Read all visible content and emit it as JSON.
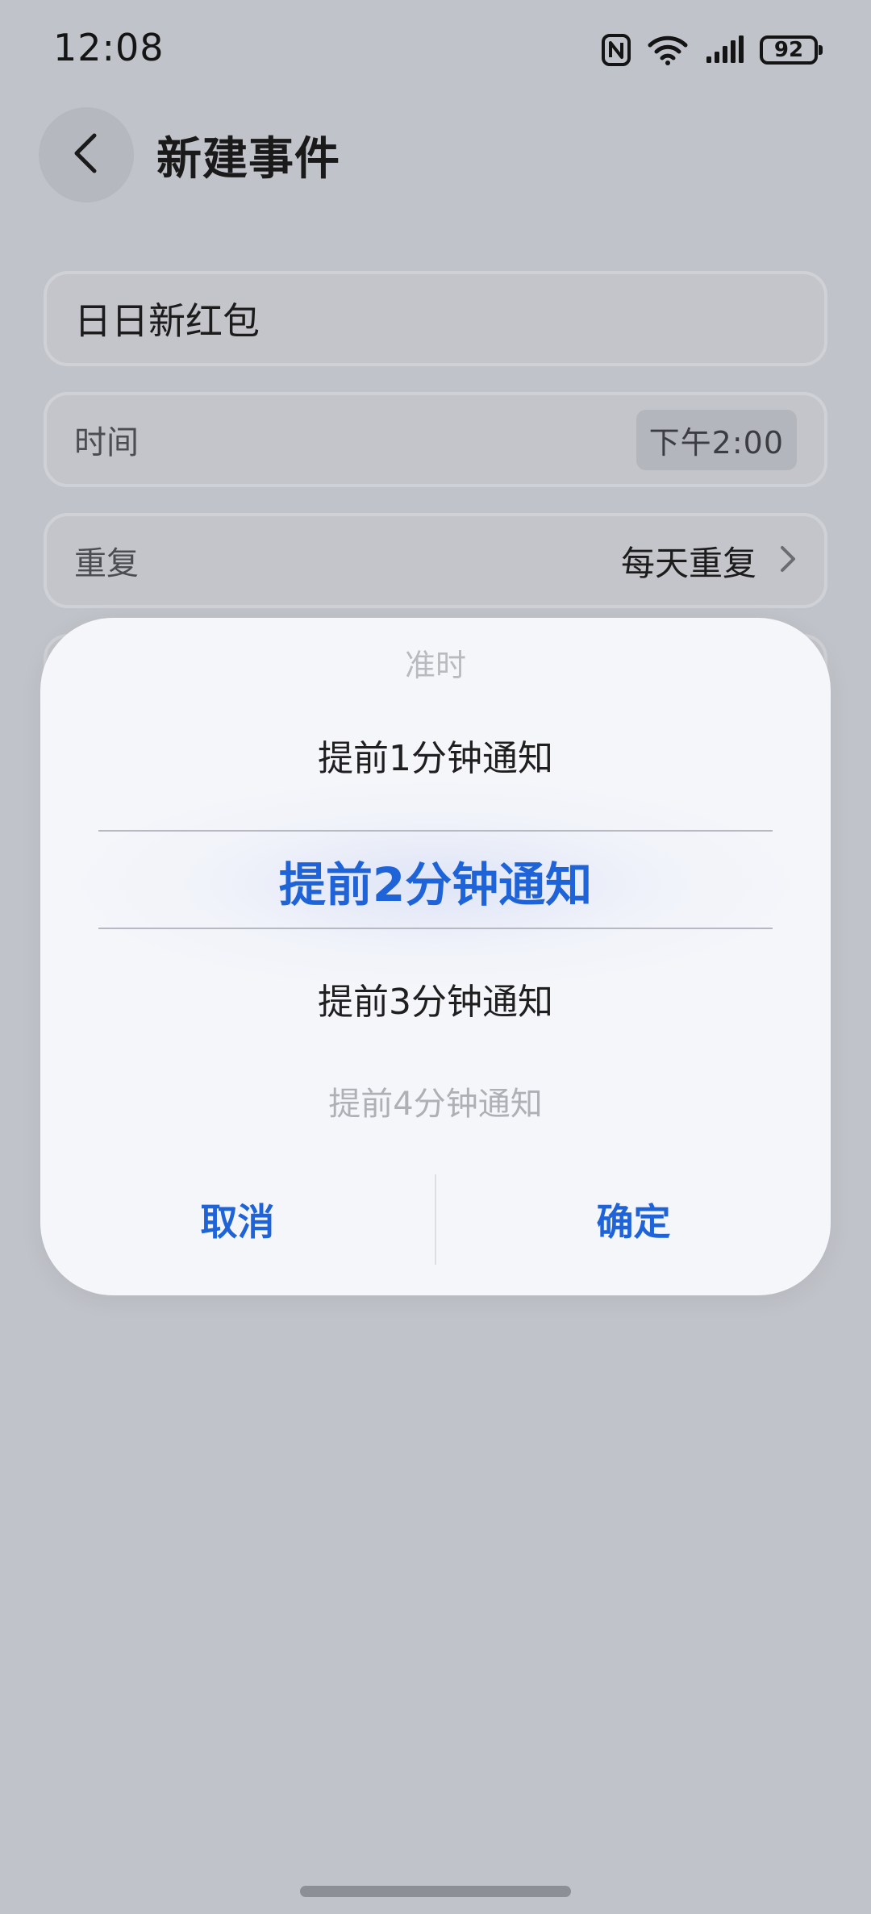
{
  "status_bar": {
    "time": "12:08",
    "battery": "92",
    "icons": [
      "nfc-icon",
      "wifi-icon",
      "signal-icon",
      "battery-icon"
    ]
  },
  "header": {
    "back_icon": "chevron-left-icon",
    "title": "新建事件"
  },
  "form": {
    "event_title": "日日新红包",
    "time_row": {
      "label": "时间",
      "value": "下午2:00"
    },
    "repeat_row": {
      "label": "重复",
      "value": "每天重复",
      "icon": "chevron-right-icon"
    }
  },
  "picker": {
    "options": [
      "准时",
      "提前1分钟通知",
      "提前2分钟通知",
      "提前3分钟通知",
      "提前4分钟通知"
    ],
    "selected_index": 2,
    "cancel_label": "取消",
    "confirm_label": "确定"
  },
  "colors": {
    "background": "#c0c3c9",
    "dialog": "#f5f6fa",
    "accent": "#1f63d8",
    "text": "#1a1a1a"
  }
}
